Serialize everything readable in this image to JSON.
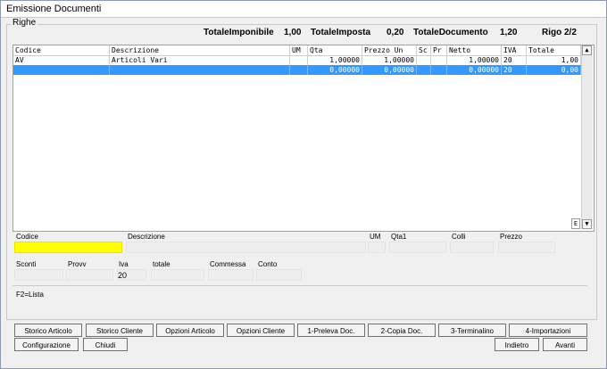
{
  "window": {
    "title": "Emissione Documenti"
  },
  "righe": {
    "group_label": "Righe",
    "totals": {
      "imponibile_label": "TotaleImponibile",
      "imponibile_value": "1,00",
      "imposta_label": "TotaleImposta",
      "imposta_value": "0,20",
      "documento_label": "TotaleDocumento",
      "documento_value": "1,20",
      "rigo": "Rigo 2/2"
    },
    "columns": [
      "Codice",
      "Descrizione",
      "UM",
      "Qta",
      "Prezzo Un",
      "Sc",
      "Pr",
      "Netto",
      "IVA",
      "Totale"
    ],
    "rows": [
      [
        "AV",
        "Articoli Vari",
        "",
        "1,00000",
        "1,00000",
        "",
        "",
        "1,00000",
        "20",
        "1,00"
      ],
      [
        "",
        "",
        "",
        "0,00000",
        "0,00000",
        "",
        "",
        "0,00000",
        "20",
        "0,00"
      ]
    ],
    "corner_button": "E"
  },
  "form": {
    "codice_label": "Codice",
    "codice_value": "",
    "descrizione_label": "Descrizione",
    "descrizione_value": "",
    "um_label": "UM",
    "um_value": "",
    "qta1_label": "Qta1",
    "qta1_value": "",
    "colli_label": "Colli",
    "colli_value": "",
    "prezzo_label": "Prezzo",
    "prezzo_value": "",
    "sconti_label": "Sconti",
    "sconti_value": "",
    "provv_label": "Provv",
    "provv_value": "",
    "iva_label": "Iva",
    "iva_value": "20",
    "totale_label": "totale",
    "totale_value": "",
    "commessa_label": "Commessa",
    "commessa_value": "",
    "conto_label": "Conto",
    "conto_value": "",
    "hint": "F2=Lista"
  },
  "buttons": {
    "storico_articolo": "Storico Articolo",
    "storico_cliente": "Storico Cliente",
    "opzioni_articolo": "Opzioni Articolo",
    "opzioni_cliente": "Opzioni Cliente",
    "preleva_doc": "1-Preleva Doc.",
    "copia_doc": "2-Copia Doc.",
    "terminalino": "3-Terminalino",
    "importazioni": "4-Importazioni",
    "configurazione": "Configurazione",
    "chiudi": "Chiudi",
    "indietro": "Indietro",
    "avanti": "Avanti"
  },
  "colors": {
    "selected_row": "#3399ff",
    "codice_field": "#ffff00"
  }
}
